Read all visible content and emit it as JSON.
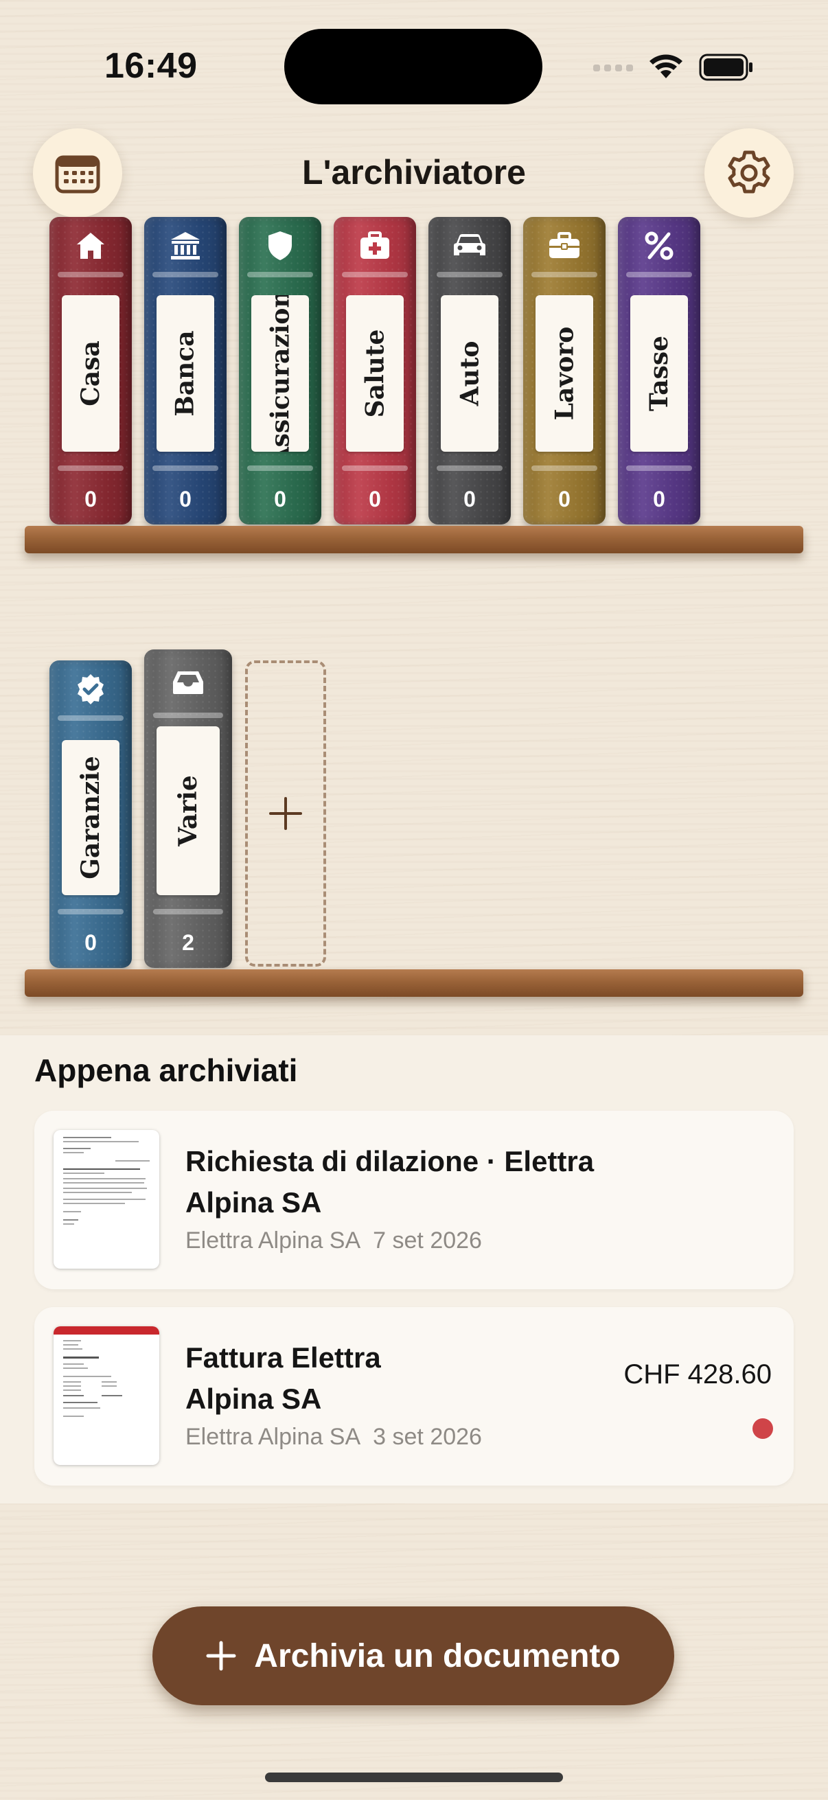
{
  "status_bar": {
    "time": "16:49"
  },
  "header": {
    "title": "L'archiviatore",
    "calendar_icon": "calendar-icon",
    "settings_icon": "gear-icon"
  },
  "shelves": {
    "top": [
      {
        "label": "Casa",
        "count": "0",
        "icon": "house-icon",
        "color": "#8e2a33"
      },
      {
        "label": "Banca",
        "count": "0",
        "icon": "bank-icon",
        "color": "#284a7c"
      },
      {
        "label": "Assicurazioni",
        "count": "0",
        "icon": "shield-icon",
        "color": "#2c7152"
      },
      {
        "label": "Salute",
        "count": "0",
        "icon": "medical-kit-icon",
        "color": "#bd3a48"
      },
      {
        "label": "Auto",
        "count": "0",
        "icon": "car-icon",
        "color": "#4a4a4c"
      },
      {
        "label": "Lavoro",
        "count": "0",
        "icon": "briefcase-icon",
        "color": "#9e7c32"
      },
      {
        "label": "Tasse",
        "count": "0",
        "icon": "percent-icon",
        "color": "#5b3a8c"
      }
    ],
    "bottom": [
      {
        "label": "Garanzie",
        "count": "0",
        "icon": "verified-badge-icon",
        "color": "#3b6f95"
      },
      {
        "label": "Varie",
        "count": "2",
        "icon": "inbox-tray-icon",
        "color": "#666666"
      }
    ],
    "add_icon": "plus-icon"
  },
  "recent": {
    "title": "Appena archiviati",
    "items": [
      {
        "title": "Richiesta di dilazione · Elettra Alpina SA",
        "sender": "Elettra Alpina SA",
        "date": "7 set 2026",
        "amount": ""
      },
      {
        "title": "Fattura Elettra Alpina SA",
        "sender": "Elettra Alpina SA",
        "date": "3 set 2026",
        "amount": "CHF 428.60",
        "status_color": "#cf4448"
      }
    ]
  },
  "archive_button": {
    "label": "Archivia un documento"
  }
}
